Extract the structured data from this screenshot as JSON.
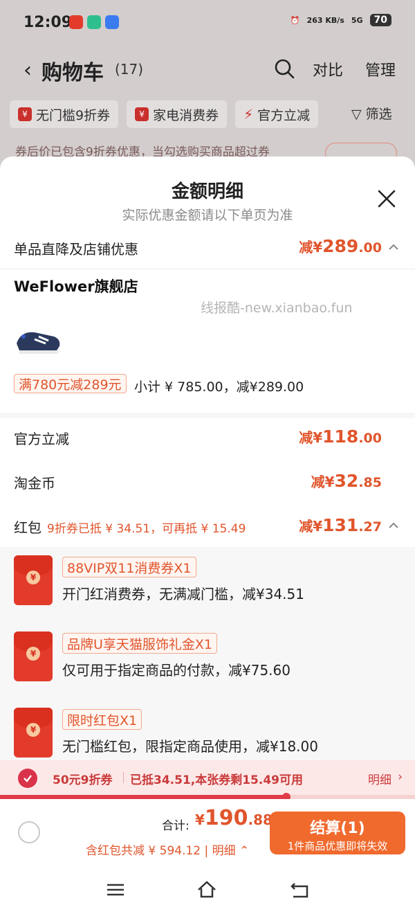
{
  "status_bar": {
    "time": "12:09",
    "net_speed": "263 KB/s",
    "signal": "5G",
    "battery": "70"
  },
  "nav": {
    "title": "购物车",
    "count": "(17)",
    "compare": "对比",
    "manage": "管理"
  },
  "filters": {
    "chips": [
      "无门槛9折券",
      "家电消费券",
      "官方立减"
    ],
    "filter_label": "筛选"
  },
  "notice": {
    "text": "券后价已包含9折券优惠，当勾选购买商品超过券"
  },
  "sheet": {
    "title": "金额明细",
    "subtitle": "实际优惠金额请以下单页为准",
    "section1": {
      "label": "单品直降及店铺优惠",
      "prefix": "减¥",
      "int": "289",
      "dec": ".00"
    },
    "store": {
      "name": "WeFlower旗舰店",
      "watermark": "线报酷-new.xianbao.fun",
      "promo": "满780元减289元",
      "subtotal": "小计 ¥ 785.00，减¥289.00"
    },
    "official": {
      "label": "官方立减",
      "prefix": "减¥",
      "int": "118",
      "dec": ".00"
    },
    "taojin": {
      "label": "淘金币",
      "prefix": "减¥",
      "int": "32",
      "dec": ".85"
    },
    "hongbao": {
      "label": "红包",
      "note": "9折券已抵 ¥ 34.51，可再抵 ¥ 15.49",
      "prefix": "减¥",
      "int": "131",
      "dec": ".27"
    },
    "coupons": [
      {
        "tag": "88VIP双11消费券X1",
        "desc": "开门红消费券，无满减门槛，减¥34.51"
      },
      {
        "tag": "品牌U享天猫服饰礼金X1",
        "desc": "仅可用于指定商品的付款，减¥75.60"
      },
      {
        "tag": "限时红包X1",
        "desc": "无门槛红包，限指定商品使用，减¥18.00"
      }
    ]
  },
  "voucher_bar": {
    "name": "50元9折券",
    "info": "已抵34.51,本张券剩15.49可用",
    "detail": "明细",
    "used_fraction": 0.69
  },
  "footer": {
    "total_label": "合计:",
    "currency": "¥",
    "total_int": "190",
    "total_dec": ".88",
    "savings": "含红包共减 ¥ 594.12 | 明细",
    "checkout": "结算(1)",
    "checkout_sub": "1件商品优惠即将失效"
  },
  "colors": {
    "accent": "#e0552c",
    "checkout_bg": "#f06a2e",
    "envelope": "#e23b2c",
    "voucher_red": "#c93a3a"
  },
  "icons": [
    "search-icon",
    "close-icon",
    "chevron-up-icon",
    "check-icon",
    "menu-icon",
    "home-icon",
    "back-icon",
    "filter-icon"
  ]
}
